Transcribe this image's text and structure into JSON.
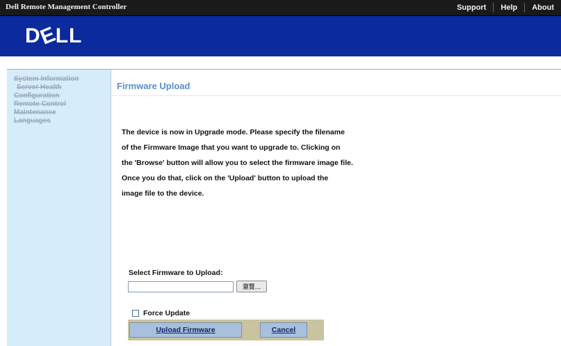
{
  "header": {
    "app_title": "Dell Remote Management Controller",
    "nav": [
      "Support",
      "Help",
      "About"
    ]
  },
  "banner": {
    "logo_before": "D",
    "logo_e": "E",
    "logo_after": "LL",
    "bg_color": "#0a2a9e"
  },
  "sidebar": {
    "items": [
      {
        "label": "System Information"
      },
      {
        "label": "Server Health"
      },
      {
        "label": "Configuration"
      },
      {
        "label": "Remote Control"
      },
      {
        "label": "Maintenance"
      },
      {
        "label": "Languages"
      }
    ]
  },
  "main": {
    "title": "Firmware Upload",
    "message_lines": [
      "The device is now in Upgrade mode. Please specify the filename",
      "of the Firmware Image that you want to upgrade to. Clicking on",
      "the 'Browse' button will allow you to select the firmware image file.",
      "Once you do that, click on the 'Upload' button to upload the",
      "image file to the device."
    ],
    "select_label": "Select Firmware to Upload:",
    "file_value": "",
    "browse_label": "瀏覽...",
    "force_label": "Force Update",
    "force_checked": false,
    "upload_label": "Upload Firmware",
    "cancel_label": "Cancel"
  }
}
